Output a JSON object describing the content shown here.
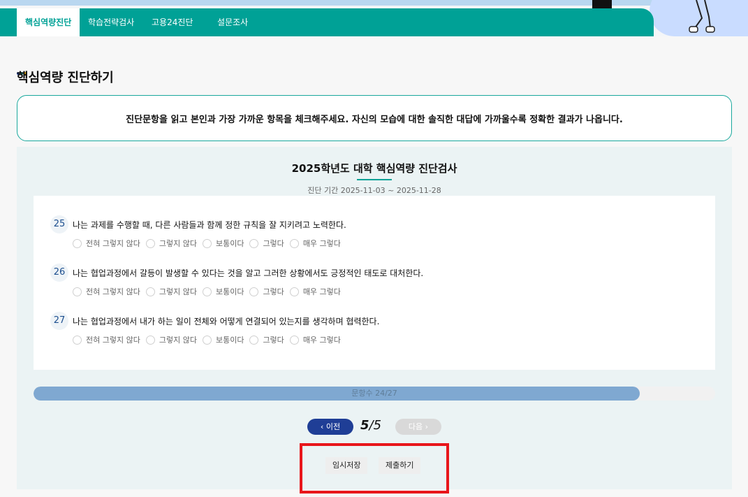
{
  "tabs": [
    {
      "label": "핵심역량진단",
      "active": true
    },
    {
      "label": "학습전략검사",
      "active": false
    },
    {
      "label": "고용24진단",
      "active": false
    },
    {
      "label": "설문조사",
      "active": false
    }
  ],
  "page_title": "핵심역량 진단하기",
  "notice": "진단문항을 읽고 본인과 가장 가까운 항목을 체크해주세요. 자신의 모습에 대한 솔직한 대답에 가까울수록 정확한 결과가 나옵니다.",
  "survey": {
    "title": "2025학년도 대학 핵심역량 진단검사",
    "period": "진단 기간 2025-11-03 ~ 2025-11-28"
  },
  "options": [
    "전혀 그렇지 않다",
    "그렇지 않다",
    "보통이다",
    "그렇다",
    "매우 그렇다"
  ],
  "questions": [
    {
      "num": "25",
      "text": "나는 과제를 수행할 때, 다른 사람들과 함께 정한 규칙을 잘 지키려고 노력한다."
    },
    {
      "num": "26",
      "text": "나는 협업과정에서 갈등이 발생할 수 있다는 것을 알고 그러한 상황에서도 긍정적인 태도로 대처한다."
    },
    {
      "num": "27",
      "text": "나는 협업과정에서 내가 하는 일이 전체와 어떻게 연결되어 있는지를 생각하며 협력한다."
    }
  ],
  "progress": {
    "label": "문항수 24/27",
    "answered": 24,
    "total": 27
  },
  "pager": {
    "prev_label": "이전",
    "next_label": "다음",
    "current": "5",
    "separator": "/",
    "total": "5"
  },
  "actions": {
    "save_label": "임시저장",
    "submit_label": "제출하기"
  },
  "colors": {
    "accent": "#00a196",
    "primary": "#1f3e96",
    "highlight": "#e8161b",
    "progress_fill": "#7fa8d1"
  }
}
